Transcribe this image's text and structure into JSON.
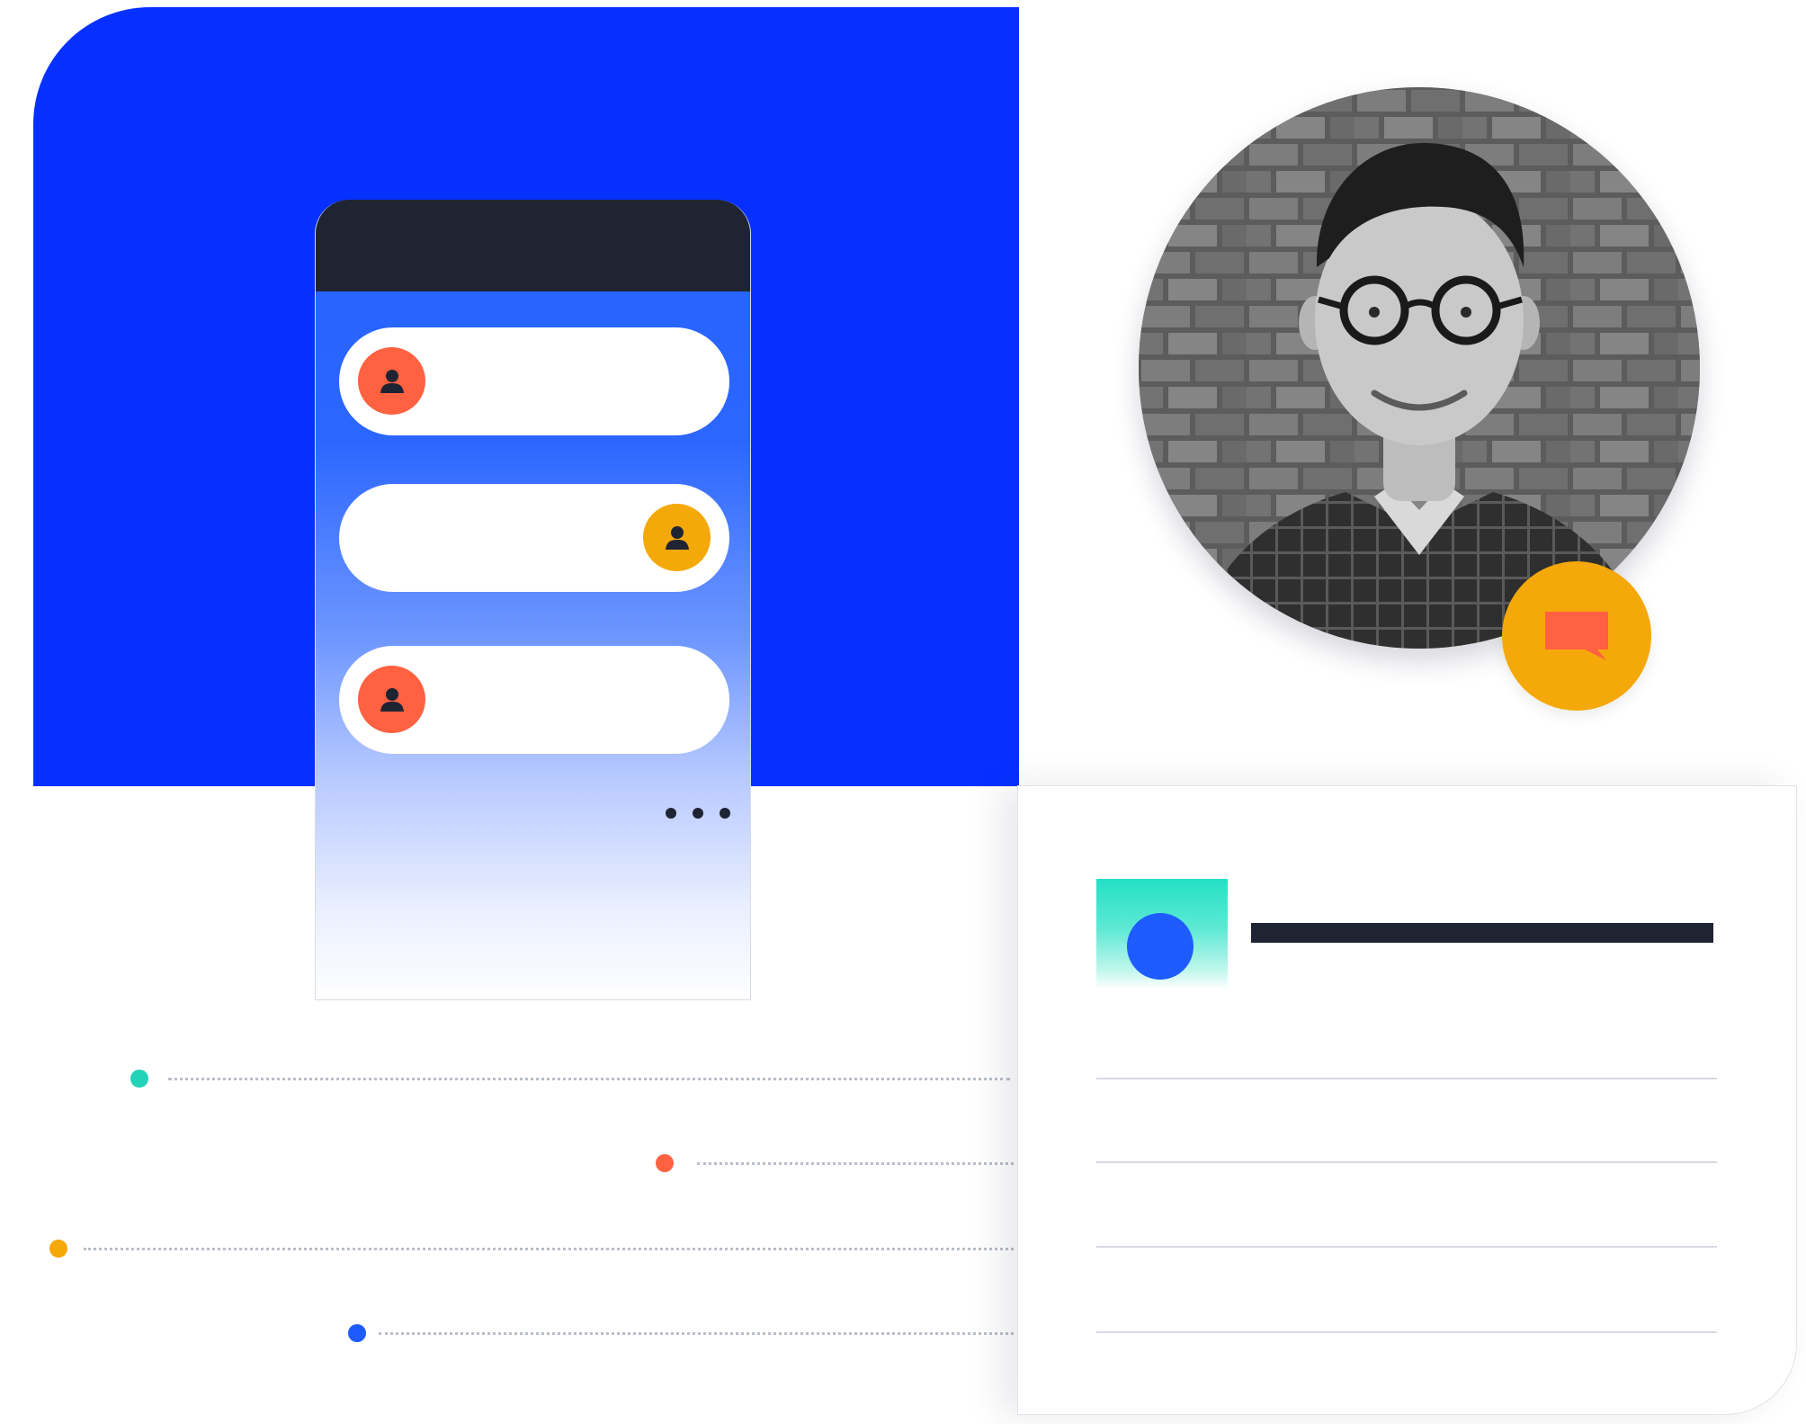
{
  "colors": {
    "accent_blue": "#0630ff",
    "phone_header": "#1f2433",
    "coral": "#ff6141",
    "amber": "#f5a80a",
    "teal": "#23d3b8",
    "royal_blue": "#1f5cff"
  },
  "phone": {
    "items": [
      {
        "icon": "user-icon",
        "icon_color": "coral",
        "position": "left"
      },
      {
        "icon": "user-icon",
        "icon_color": "amber",
        "position": "right"
      },
      {
        "icon": "user-icon",
        "icon_color": "coral",
        "position": "left"
      }
    ],
    "more_icon": "more-dots-icon"
  },
  "profile": {
    "photo": "portrait-photo",
    "badge_icon": "chat-bubble-icon"
  },
  "timeline": [
    {
      "color": "teal"
    },
    {
      "color": "coral"
    },
    {
      "color": "amber"
    },
    {
      "color": "royal_blue"
    }
  ],
  "card": {
    "thumbnail": "thumbnail-image",
    "rule_count": 4
  }
}
